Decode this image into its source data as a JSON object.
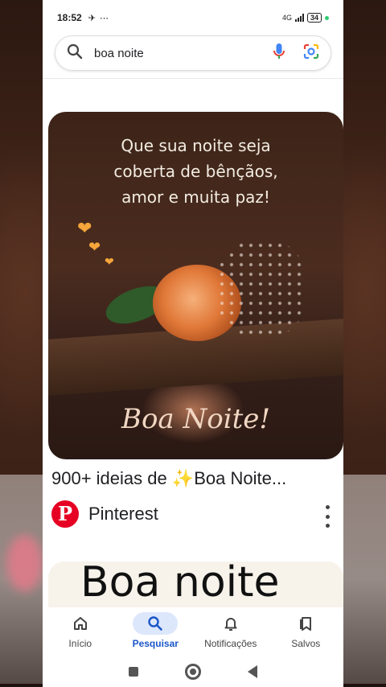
{
  "status_bar": {
    "time": "18:52",
    "left_icons": "✈ ⋯",
    "network": "4G",
    "battery": "34"
  },
  "search": {
    "query": "boa noite"
  },
  "result": {
    "image_text_lines": [
      "Que sua noite seja",
      "coberta de bênçãos,",
      "amor e muita paz!"
    ],
    "image_script": "Boa Noite!",
    "title": "900+ ideias de ✨Boa Noite...",
    "source": "Pinterest",
    "source_logo_letter": "P"
  },
  "next_result": {
    "image_text": "Boa noite"
  },
  "bottom_nav": [
    {
      "label": "Início",
      "icon": "home-icon",
      "active": false
    },
    {
      "label": "Pesquisar",
      "icon": "search-icon",
      "active": true
    },
    {
      "label": "Notificações",
      "icon": "bell-icon",
      "active": false
    },
    {
      "label": "Salvos",
      "icon": "bookmark-icon",
      "active": false
    }
  ],
  "colors": {
    "accent": "#1a56c9",
    "pinterest": "#e60023"
  }
}
